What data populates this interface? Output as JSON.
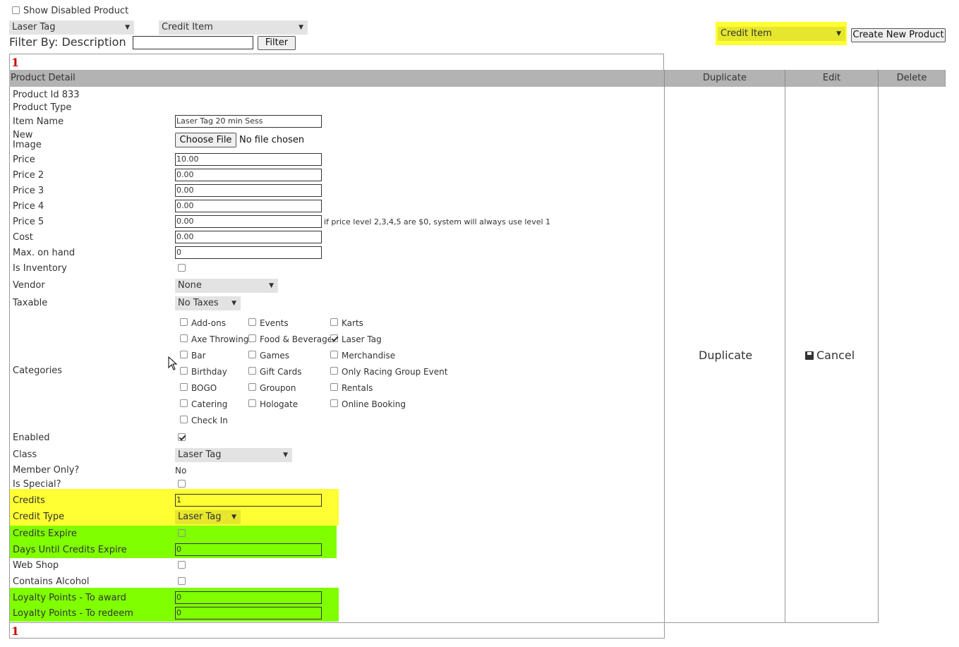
{
  "top": {
    "show_disabled_label": "Show Disabled Product",
    "category_filter": "Laser Tag",
    "type_filter": "Credit Item",
    "filter_by_label": "Filter By: Description",
    "filter_value": "",
    "filter_button": "Filter",
    "new_product_type": "Credit Item",
    "create_button": "Create New Product"
  },
  "pager": {
    "page": "1"
  },
  "table": {
    "headers": [
      "Product Detail",
      "Duplicate",
      "Edit",
      "Delete"
    ],
    "duplicate_action": "Duplicate",
    "cancel_action": "Cancel"
  },
  "product": {
    "id_label": "Product Id 833",
    "type_label": "Product Type",
    "item_name_label": "Item Name",
    "item_name": "Laser Tag 20 min Sess",
    "new_image_label_1": "New",
    "new_image_label_2": "Image",
    "choose_file": "Choose File",
    "no_file": "No file chosen",
    "price_label": "Price",
    "price": "10.00",
    "price2_label": "Price 2",
    "price2": "0.00",
    "price3_label": "Price 3",
    "price3": "0.00",
    "price4_label": "Price 4",
    "price4": "0.00",
    "price5_label": "Price 5",
    "price5": "0.00",
    "price_note": "if price level 2,3,4,5 are $0, system will always use level 1",
    "cost_label": "Cost",
    "cost": "0.00",
    "max_on_hand_label": "Max. on hand",
    "max_on_hand": "0",
    "is_inventory_label": "Is Inventory",
    "vendor_label": "Vendor",
    "vendor": "None",
    "taxable_label": "Taxable",
    "taxable": "No Taxes",
    "categories_label": "Categories",
    "categories": [
      {
        "name": "Add-ons",
        "checked": false
      },
      {
        "name": "Axe Throwing",
        "checked": false
      },
      {
        "name": "Bar",
        "checked": false
      },
      {
        "name": "Birthday",
        "checked": false
      },
      {
        "name": "BOGO",
        "checked": false
      },
      {
        "name": "Catering",
        "checked": false
      },
      {
        "name": "Check In",
        "checked": false
      },
      {
        "name": "Events",
        "checked": false
      },
      {
        "name": "Food & Beverage",
        "checked": false
      },
      {
        "name": "Games",
        "checked": false
      },
      {
        "name": "Gift Cards",
        "checked": false
      },
      {
        "name": "Groupon",
        "checked": false
      },
      {
        "name": "Hologate",
        "checked": false
      },
      {
        "name": "Karts",
        "checked": false
      },
      {
        "name": "Laser Tag",
        "checked": true
      },
      {
        "name": "Merchandise",
        "checked": false
      },
      {
        "name": "Only Racing Group Event",
        "checked": false
      },
      {
        "name": "Rentals",
        "checked": false
      },
      {
        "name": "Online Booking",
        "checked": false
      }
    ],
    "enabled_label": "Enabled",
    "class_label": "Class",
    "class": "Laser Tag",
    "member_only_label": "Member Only?",
    "member_only": "No",
    "is_special_label": "Is Special?",
    "credits_label": "Credits",
    "credits": "1",
    "credit_type_label": "Credit Type",
    "credit_type": "Laser Tag",
    "credits_expire_label": "Credits Expire",
    "days_until_expire_label": "Days Until Credits Expire",
    "days_until_expire": "0",
    "web_shop_label": "Web Shop",
    "contains_alcohol_label": "Contains Alcohol",
    "loyalty_award_label": "Loyalty Points - To award",
    "loyalty_award": "0",
    "loyalty_redeem_label": "Loyalty Points - To redeem",
    "loyalty_redeem": "0"
  },
  "colors": {
    "highlight_yellow": "#ffff33",
    "highlight_green": "#80ff00",
    "header_gray": "#b3b3b3"
  }
}
